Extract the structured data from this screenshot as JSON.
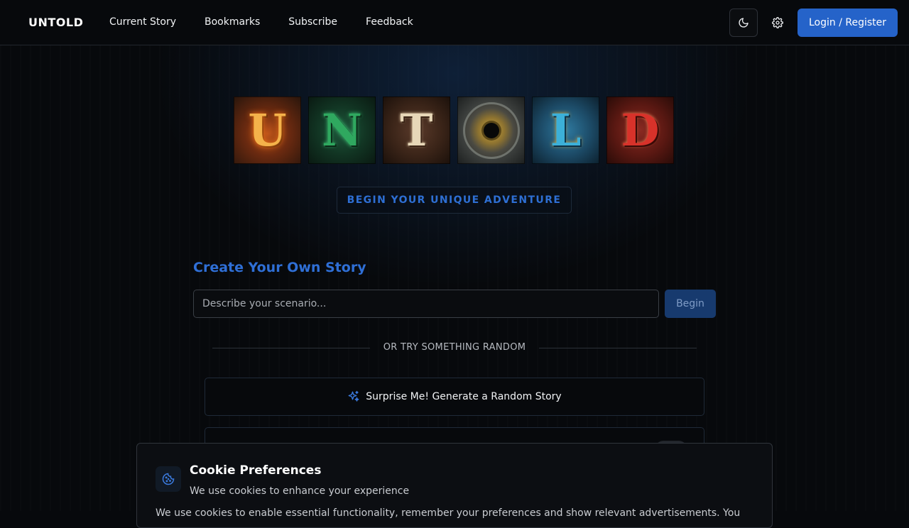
{
  "nav": {
    "brand": "UNTOLD",
    "links": [
      "Current Story",
      "Bookmarks",
      "Subscribe",
      "Feedback"
    ],
    "theme_icon": "moon-icon",
    "settings_icon": "gear-icon",
    "login_label": "Login / Register"
  },
  "hero": {
    "logo_letters": [
      "U",
      "N",
      "T",
      "O",
      "L",
      "D"
    ],
    "adventure_label": "BEGIN YOUR UNIQUE ADVENTURE"
  },
  "create": {
    "title": "Create Your Own Story",
    "placeholder": "Describe your scenario...",
    "begin_label": "Begin",
    "divider_text": "OR TRY SOMETHING RANDOM",
    "surprise_label": "Surprise Me! Generate a Random Story",
    "surprise_icon": "sparkle-icon"
  },
  "cookie": {
    "icon": "cookie-icon",
    "title": "Cookie Preferences",
    "subtitle": "We use cookies to enhance your experience",
    "body": "We use cookies to enable essential functionality, remember your preferences and show relevant advertisements. You"
  },
  "colors": {
    "accent": "#2563c9",
    "title_blue": "#2f6fd6",
    "background": "#07090c"
  }
}
